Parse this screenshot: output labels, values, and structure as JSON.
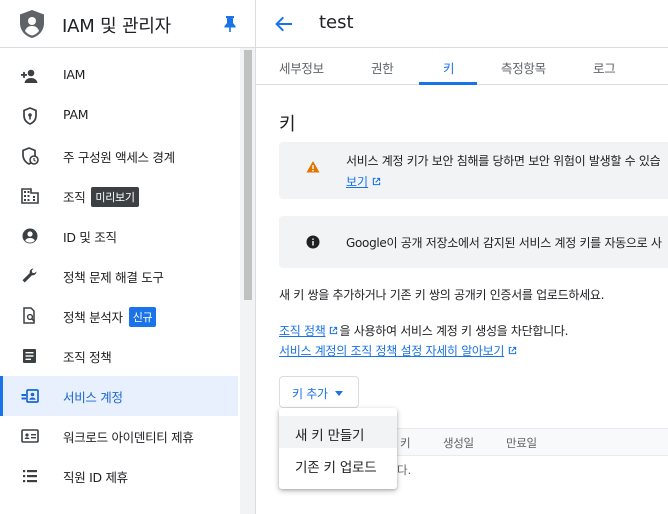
{
  "sidebar": {
    "title": "IAM 및 관리자",
    "items": [
      {
        "label": "IAM",
        "icon": "person-add-icon"
      },
      {
        "label": "PAM",
        "icon": "shield-check-icon"
      },
      {
        "label": "주 구성원 액세스 경계",
        "icon": "shield-clock-icon"
      },
      {
        "label": "조직",
        "icon": "building-icon",
        "badge": "미리보기"
      },
      {
        "label": "ID 및 조직",
        "icon": "account-circle-icon"
      },
      {
        "label": "정책 문제 해결 도구",
        "icon": "wrench-icon"
      },
      {
        "label": "정책 분석자",
        "icon": "document-search-icon",
        "badge": "신규"
      },
      {
        "label": "조직 정책",
        "icon": "list-doc-icon"
      },
      {
        "label": "서비스 계정",
        "icon": "service-account-icon"
      },
      {
        "label": "워크로드 아이덴티티 제휴",
        "icon": "id-card-icon"
      },
      {
        "label": "직원 ID 제휴",
        "icon": "list-icon"
      }
    ]
  },
  "header": {
    "title": "test"
  },
  "tabs": [
    {
      "label": "세부정보"
    },
    {
      "label": "권한"
    },
    {
      "label": "키"
    },
    {
      "label": "측정항목"
    },
    {
      "label": "로그"
    }
  ],
  "section_title": "키",
  "warning_banner": {
    "text": "서비스 계정 키가 보안 침해를 당하면 보안 위험이 발생할 수 있습",
    "link": "보기"
  },
  "info_banner": {
    "text": "Google이 공개 저장소에서 감지된 서비스 계정 키를 자동으로 사"
  },
  "description": "새 키 쌍을 추가하거나 기존 키 쌍의 공개키 인증서를 업로드하세요.",
  "policy": {
    "link1": "조직 정책",
    "text1": "을 사용하여 서비스 계정 키 생성을 차단합니다.",
    "link2": "서비스 계정의 조직 정책 설정 자세히 알아보기"
  },
  "add_key": {
    "label": "키 추가"
  },
  "menu": {
    "items": [
      "새 키 만들기",
      "기존 키 업로드"
    ]
  },
  "table": {
    "headers": [
      "키",
      "생성일",
      "만료일"
    ],
    "empty_fragment": "다."
  },
  "colors": {
    "accent": "#1a73e8",
    "warning": "#e37400",
    "badge_dark": "#3c4043"
  }
}
